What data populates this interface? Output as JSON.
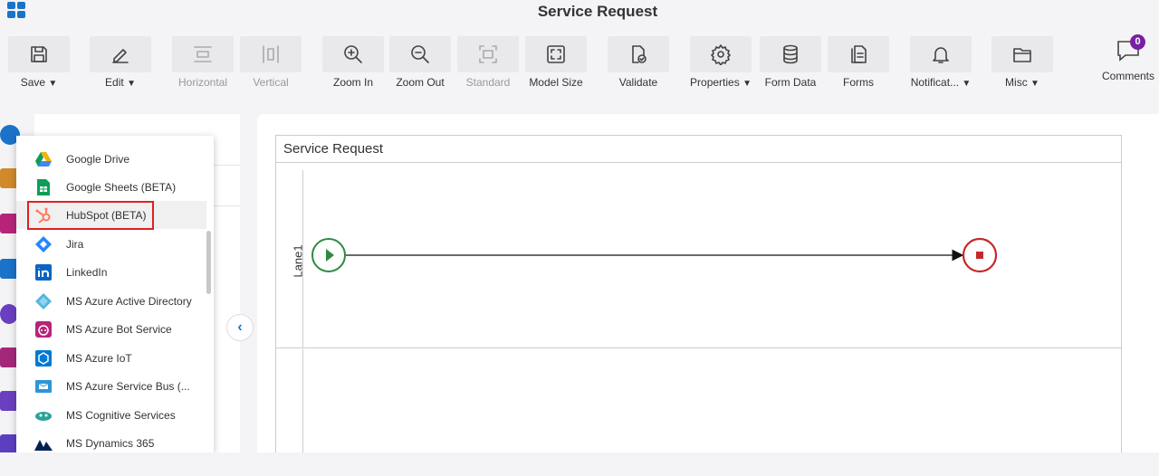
{
  "header": {
    "title": "Service Request"
  },
  "toolbar": {
    "save": "Save",
    "edit": "Edit",
    "horizontal": "Horizontal",
    "vertical": "Vertical",
    "zoom_in": "Zoom In",
    "zoom_out": "Zoom Out",
    "standard": "Standard",
    "model_size": "Model Size",
    "validate": "Validate",
    "properties": "Properties",
    "form_data": "Form Data",
    "forms": "Forms",
    "notifications": "Notificat...",
    "misc": "Misc",
    "comments": "Comments",
    "comments_count": "0"
  },
  "dropdown": {
    "items": [
      {
        "label": "Google Drive",
        "icon": "google-drive-icon"
      },
      {
        "label": "Google Sheets (BETA)",
        "icon": "google-sheets-icon"
      },
      {
        "label": "HubSpot (BETA)",
        "icon": "hubspot-icon",
        "highlighted": true
      },
      {
        "label": "Jira",
        "icon": "jira-icon"
      },
      {
        "label": "LinkedIn",
        "icon": "linkedin-icon"
      },
      {
        "label": "MS Azure Active Directory",
        "icon": "azure-ad-icon"
      },
      {
        "label": "MS Azure Bot Service",
        "icon": "azure-bot-icon"
      },
      {
        "label": "MS Azure IoT",
        "icon": "azure-iot-icon"
      },
      {
        "label": "MS Azure Service Bus (...",
        "icon": "azure-service-bus-icon"
      },
      {
        "label": "MS Cognitive Services",
        "icon": "cognitive-services-icon"
      },
      {
        "label": "MS Dynamics 365",
        "icon": "dynamics-365-icon"
      }
    ]
  },
  "diagram": {
    "pool_title": "Service Request",
    "lane_label": "Lane1"
  },
  "colors": {
    "accent": "#1a73c8",
    "start_event": "#2e8b3e",
    "end_event": "#c62828",
    "highlight_border": "#e02020",
    "badge": "#7a1fa2"
  }
}
